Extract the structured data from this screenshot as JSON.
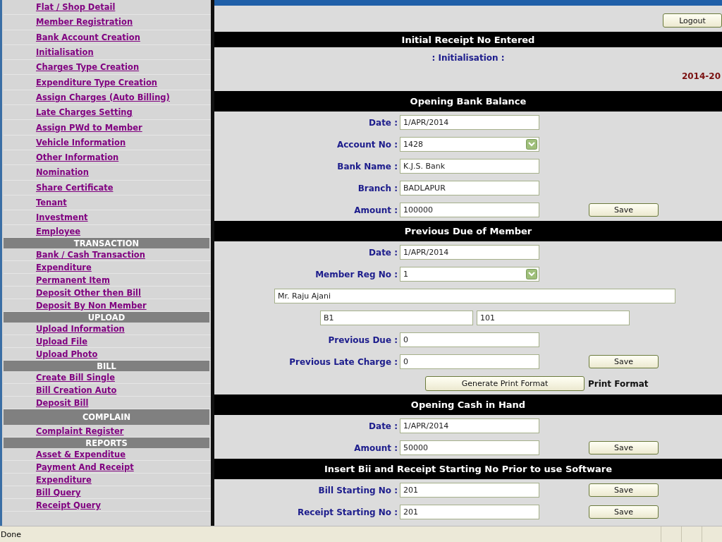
{
  "sidebar": {
    "groups": [
      {
        "items": [
          "Flat / Shop Detail",
          "Member Registration",
          "Bank Account Creation",
          "Initialisation",
          "Charges Type Creation",
          "Expenditure Type Creation",
          "Assign Charges (Auto Billing)",
          "Late Charges Setting",
          "Assign PWd to Member",
          "Vehicle Information",
          "Other Information",
          "Nomination",
          "Share Certificate",
          "Tenant",
          "Investment",
          "Employee"
        ]
      },
      {
        "title": "TRANSACTION",
        "items": [
          "Bank / Cash Transaction",
          "Expenditure",
          "Permanent Item",
          "Deposit Other then Bill",
          "Deposit By Non Member"
        ]
      },
      {
        "title": "UPLOAD",
        "items": [
          "Upload Information",
          "Upload File",
          "Upload Photo"
        ]
      },
      {
        "title": "BILL",
        "items": [
          "Create Bill Single",
          "Bill Creation Auto",
          "Deposit Bill"
        ]
      },
      {
        "title": "COMPLAIN",
        "items": [
          "Complaint Register"
        ]
      },
      {
        "title": "REPORTS",
        "items": [
          "Asset & Expenditue",
          "Payment And Receipt",
          "Expenditure",
          "Bill Query",
          "Receipt Query"
        ]
      }
    ]
  },
  "logout": "Logout",
  "notice": "Initial Receipt No Entered",
  "page_title": ": Initialisation :",
  "year": "2014-20",
  "sections": [
    {
      "title": "Opening Bank Balance",
      "rows": [
        {
          "kind": "field",
          "label": "Date :",
          "value": "1/APR/2014"
        },
        {
          "kind": "select",
          "label": "Account No :",
          "value": "1428"
        },
        {
          "kind": "field",
          "label": "Bank Name :",
          "value": "K.J.S. Bank"
        },
        {
          "kind": "field",
          "label": "Branch :",
          "value": "BADLAPUR"
        },
        {
          "kind": "field",
          "label": "Amount :",
          "value": "100000",
          "button": "Save"
        }
      ]
    },
    {
      "title": "Previous Due of Member",
      "rows": [
        {
          "kind": "field",
          "label": "Date :",
          "value": "1/APR/2014"
        },
        {
          "kind": "select",
          "label": "Member Reg No :",
          "value": "1"
        },
        {
          "kind": "wide",
          "value": "Mr. Raju Ajani"
        },
        {
          "kind": "pair",
          "values": [
            "B1",
            "101"
          ]
        },
        {
          "kind": "field",
          "label": "Previous Due :",
          "value": "0"
        },
        {
          "kind": "field",
          "label": "Previous Late Charge :",
          "value": "0",
          "button": "Save"
        },
        {
          "kind": "action",
          "button": "Generate Print Format",
          "text": "Print Format"
        }
      ]
    },
    {
      "title": "Opening Cash in Hand",
      "rows": [
        {
          "kind": "field",
          "label": "Date :",
          "value": "1/APR/2014"
        },
        {
          "kind": "field",
          "label": "Amount :",
          "value": "50000",
          "button": "Save"
        }
      ]
    },
    {
      "title": "Insert Bii and Receipt Starting No Prior to use Software",
      "rows": [
        {
          "kind": "field",
          "label": "Bill Starting No :",
          "value": "201",
          "button": "Save"
        },
        {
          "kind": "field",
          "label": "Receipt Starting No :",
          "value": "201",
          "button": "Save"
        }
      ]
    }
  ],
  "status_bar": "Done"
}
